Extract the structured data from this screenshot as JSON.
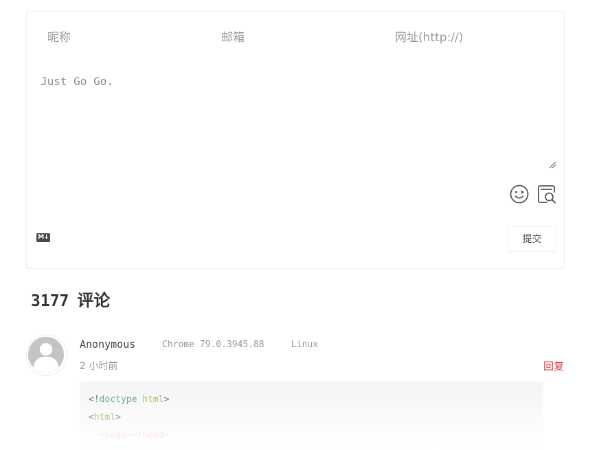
{
  "form": {
    "nick_placeholder": "昵称",
    "mail_placeholder": "邮箱",
    "link_placeholder": "网址(http://)",
    "editor_placeholder": "Just Go Go.",
    "markdown_badge": "M↓",
    "submit_label": "提交"
  },
  "comments_header": {
    "count": "3177",
    "label": "评论"
  },
  "comment": {
    "author": "Anonymous",
    "browser": "Chrome 79.0.3945.88",
    "os": "Linux",
    "time": "2 小时前",
    "reply_label": "回复",
    "code": {
      "line1_open": "<!",
      "line1_kw": "doctype",
      "line1_attr": " html",
      "line1_close": ">",
      "line2_open": "<",
      "line2_tag": "html",
      "line2_close": ">",
      "line3": "  <head></head>"
    }
  },
  "colors": {
    "reply": "#e5343a",
    "code_keyword": "#6ab18f",
    "code_tag": "#a8c36b"
  }
}
